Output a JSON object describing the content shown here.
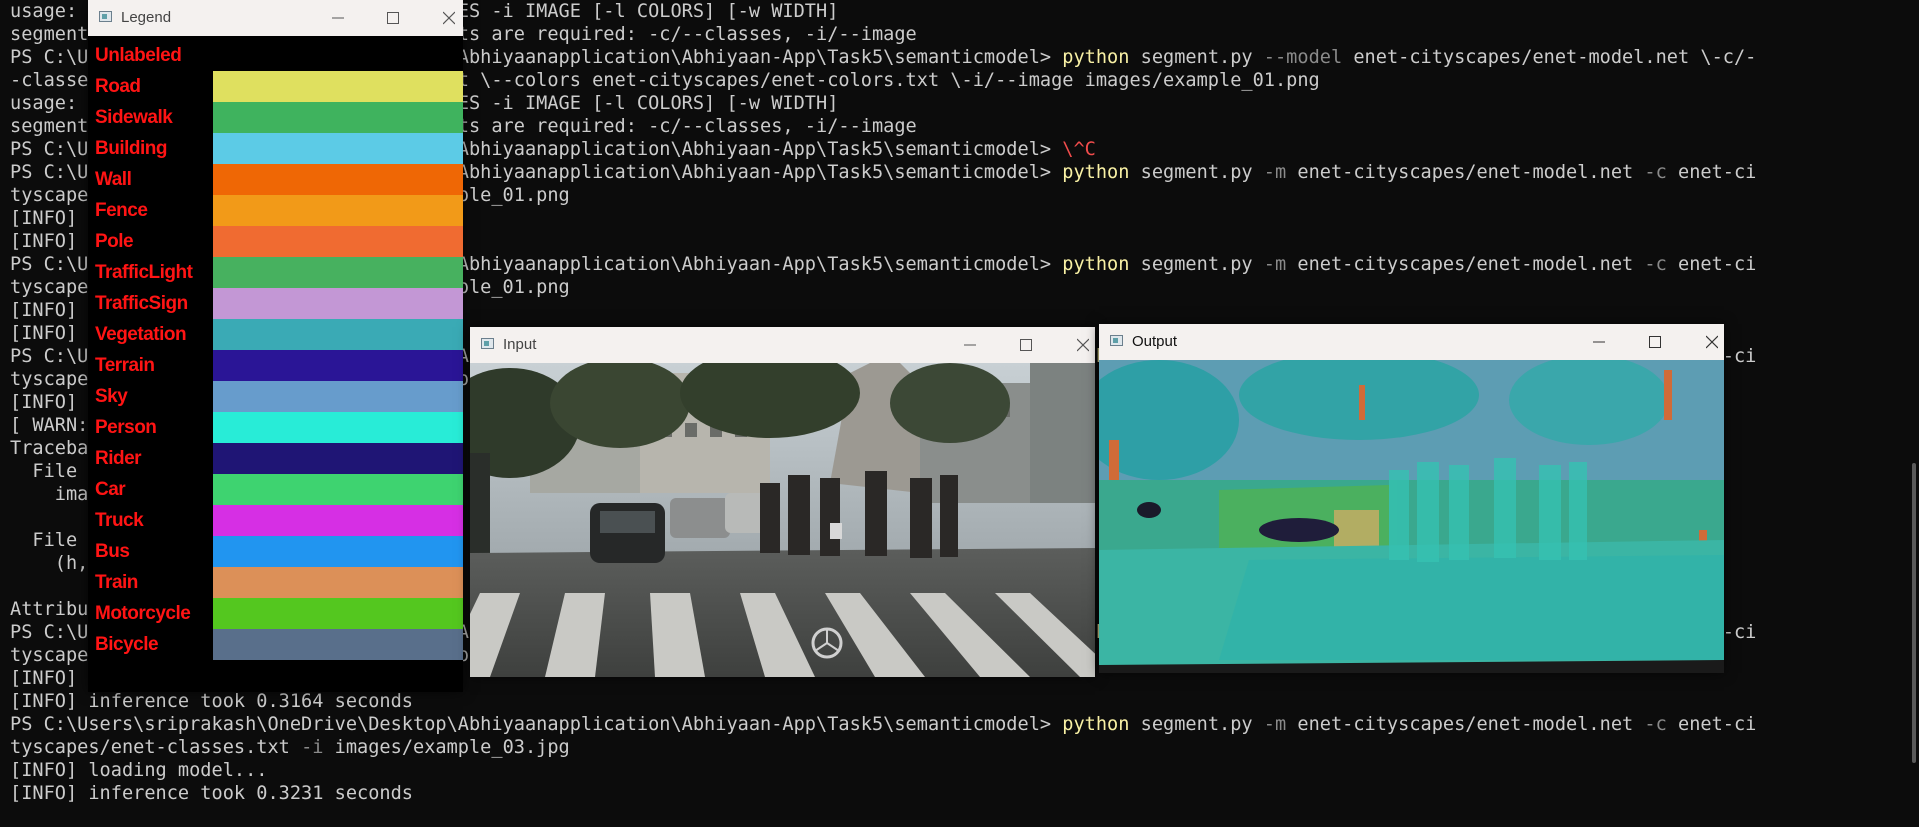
{
  "terminal": {
    "lines": [
      [
        {
          "t": "usage: segment.py [-h] -m MODEL -c CLASSES -i IMAGE [-l COLORS] [-w WIDTH]",
          "c": "#cccccc"
        }
      ],
      [
        {
          "t": "segment.py: error: the following arguments are required: -c/--classes, -i/--image",
          "c": "#cccccc"
        }
      ],
      [
        {
          "t": "PS C:\\Users\\sriprakash\\OneDrive\\Desktop\\Abhiyaanapplication\\Abhiyaan-App\\Task5\\semanticmodel> ",
          "c": "#cccccc"
        },
        {
          "t": "python",
          "c": "#f9f1a5"
        },
        {
          "t": " segment.py ",
          "c": "#cccccc"
        },
        {
          "t": "--model",
          "c": "#8a8a8a"
        },
        {
          "t": " enet-cityscapes/enet-model.net \\-c/-",
          "c": "#cccccc"
        }
      ],
      [
        {
          "t": "-classes enet-cityscapes/enet-classes.txt \\--colors enet-cityscapes/enet-colors.txt \\-i/--image images/example_01.png",
          "c": "#cccccc"
        }
      ],
      [
        {
          "t": "usage: segment.py [-h] -m MODEL -c CLASSES -i IMAGE [-l COLORS] [-w WIDTH]",
          "c": "#cccccc"
        }
      ],
      [
        {
          "t": "segment.py: error: the following arguments are required: -c/--classes, -i/--image",
          "c": "#cccccc"
        }
      ],
      [
        {
          "t": "PS C:\\Users\\sriprakash\\OneDrive\\Desktop\\Abhiyaanapplication\\Abhiyaan-App\\Task5\\semanticmodel> ",
          "c": "#cccccc"
        },
        {
          "t": "\\^C",
          "c": "#f14c4c"
        }
      ],
      [
        {
          "t": "PS C:\\Users\\sriprakash\\OneDrive\\Desktop\\Abhiyaanapplication\\Abhiyaan-App\\Task5\\semanticmodel> ",
          "c": "#cccccc"
        },
        {
          "t": "python",
          "c": "#f9f1a5"
        },
        {
          "t": " segment.py ",
          "c": "#cccccc"
        },
        {
          "t": "-m",
          "c": "#8a8a8a"
        },
        {
          "t": " enet-cityscapes/enet-model.net ",
          "c": "#cccccc"
        },
        {
          "t": "-c",
          "c": "#8a8a8a"
        },
        {
          "t": " enet-ci",
          "c": "#cccccc"
        }
      ],
      [
        {
          "t": "tyscapes/enet-classes.txt -i images/example_01.png",
          "c": "#cccccc"
        }
      ],
      [
        {
          "t": "[INFO] loading model...",
          "c": "#cccccc"
        }
      ],
      [
        {
          "t": "[INFO] inference took 0.3164 seconds",
          "c": "#cccccc"
        }
      ],
      [
        {
          "t": "PS C:\\Users\\sriprakash\\OneDrive\\Desktop\\Abhiyaanapplication\\Abhiyaan-App\\Task5\\semanticmodel> ",
          "c": "#cccccc"
        },
        {
          "t": "python",
          "c": "#f9f1a5"
        },
        {
          "t": " segment.py ",
          "c": "#cccccc"
        },
        {
          "t": "-m",
          "c": "#8a8a8a"
        },
        {
          "t": " enet-cityscapes/enet-model.net ",
          "c": "#cccccc"
        },
        {
          "t": "-c",
          "c": "#8a8a8a"
        },
        {
          "t": " enet-ci",
          "c": "#cccccc"
        }
      ],
      [
        {
          "t": "tyscapes/enet-classes.txt -i images/example_01.png",
          "c": "#cccccc"
        }
      ],
      [
        {
          "t": "[INFO] loading model...",
          "c": "#cccccc"
        }
      ],
      [
        {
          "t": "[INFO] inference took 0.3164 seconds",
          "c": "#cccccc"
        }
      ],
      [
        {
          "t": "PS C:\\Users\\sriprakash\\OneDrive\\Desktop\\Abhiyaanapplication\\Abhiyaan-App\\Task5\\semanticmodel> ",
          "c": "#cccccc"
        },
        {
          "t": "python",
          "c": "#f9f1a5"
        },
        {
          "t": " segment.py ",
          "c": "#cccccc"
        },
        {
          "t": "-m",
          "c": "#8a8a8a"
        },
        {
          "t": " enet-cityscapes/enet-model.net ",
          "c": "#cccccc"
        },
        {
          "t": "-c",
          "c": "#8a8a8a"
        },
        {
          "t": " enet-ci",
          "c": "#cccccc"
        }
      ],
      [
        {
          "t": "tyscapes/enet-classes.txt -i images/example_01.png",
          "c": "#cccccc"
        }
      ],
      [
        {
          "t": "[INFO] loading model...",
          "c": "#cccccc"
        }
      ],
      [
        {
          "t": "[ WARN:0] global",
          "c": "#cccccc"
        }
      ],
      [
        {
          "t": "Traceback (most recent call last):",
          "c": "#cccccc"
        }
      ],
      [
        {
          "t": "  File \"segment.py\"",
          "c": "#cccccc"
        }
      ],
      [
        {
          "t": "    image",
          "c": "#cccccc"
        }
      ],
      [
        {
          "t": "",
          "c": "#cccccc"
        }
      ],
      [
        {
          "t": "  File \"segment.py\"",
          "c": "#cccccc"
        }
      ],
      [
        {
          "t": "    (h, w)",
          "c": "#cccccc"
        }
      ],
      [
        {
          "t": "",
          "c": "#cccccc"
        }
      ],
      [
        {
          "t": "AttributeError: 'NoneType' object has no attribute 'shape'",
          "c": "#cccccc"
        }
      ],
      [
        {
          "t": "PS C:\\Users\\sriprakash\\OneDrive\\Desktop\\Abhiyaanapplication\\Abhiyaan-App\\Task5\\semanticmodel> ",
          "c": "#cccccc"
        },
        {
          "t": "python",
          "c": "#f9f1a5"
        },
        {
          "t": " segment.py ",
          "c": "#cccccc"
        },
        {
          "t": "-m",
          "c": "#8a8a8a"
        },
        {
          "t": " enet-cityscapes/enet-model.net ",
          "c": "#cccccc"
        },
        {
          "t": "-c",
          "c": "#8a8a8a"
        },
        {
          "t": " enet-ci",
          "c": "#cccccc"
        }
      ],
      [
        {
          "t": "tyscapes/enet-classes.txt -i images/example_02.jpg",
          "c": "#cccccc"
        }
      ],
      [
        {
          "t": "[INFO] loading model...",
          "c": "#cccccc"
        }
      ],
      [
        {
          "t": "[INFO] inference took 0.3164 seconds",
          "c": "#cccccc"
        }
      ],
      [
        {
          "t": "PS C:\\Users\\sriprakash\\OneDrive\\Desktop\\Abhiyaanapplication\\Abhiyaan-App\\Task5\\semanticmodel> ",
          "c": "#cccccc"
        },
        {
          "t": "python",
          "c": "#f9f1a5"
        },
        {
          "t": " segment.py ",
          "c": "#cccccc"
        },
        {
          "t": "-m",
          "c": "#8a8a8a"
        },
        {
          "t": " enet-cityscapes/enet-model.net ",
          "c": "#cccccc"
        },
        {
          "t": "-c",
          "c": "#8a8a8a"
        },
        {
          "t": " enet-ci",
          "c": "#cccccc"
        }
      ],
      [
        {
          "t": "tyscapes/enet-classes.txt ",
          "c": "#cccccc"
        },
        {
          "t": "-i",
          "c": "#8a8a8a"
        },
        {
          "t": " images/example_03.jpg",
          "c": "#cccccc"
        }
      ],
      [
        {
          "t": "[INFO] loading model...",
          "c": "#cccccc"
        }
      ],
      [
        {
          "t": "[INFO] inference took 0.3231 seconds",
          "c": "#cccccc"
        }
      ]
    ]
  },
  "legend": {
    "title": "Legend",
    "icon": "opencv-window-icon",
    "classes": [
      {
        "name": "Unlabeled",
        "color": "#000000"
      },
      {
        "name": "Road",
        "color": "#dfe05f"
      },
      {
        "name": "Sidewalk",
        "color": "#3fb35e"
      },
      {
        "name": "Building",
        "color": "#5ccbe6"
      },
      {
        "name": "Wall",
        "color": "#ef6705"
      },
      {
        "name": "Fence",
        "color": "#f29a18"
      },
      {
        "name": "Pole",
        "color": "#f06b31"
      },
      {
        "name": "TrafficLight",
        "color": "#47b15f"
      },
      {
        "name": "TrafficSign",
        "color": "#c397d5"
      },
      {
        "name": "Vegetation",
        "color": "#3aaab5"
      },
      {
        "name": "Terrain",
        "color": "#2a1596"
      },
      {
        "name": "Sky",
        "color": "#679ccc"
      },
      {
        "name": "Person",
        "color": "#28ecd7"
      },
      {
        "name": "Rider",
        "color": "#1f1575"
      },
      {
        "name": "Car",
        "color": "#3ed370"
      },
      {
        "name": "Truck",
        "color": "#d62fe4"
      },
      {
        "name": "Bus",
        "color": "#2195f0"
      },
      {
        "name": "Train",
        "color": "#dc9058"
      },
      {
        "name": "Motorcycle",
        "color": "#54c71f"
      },
      {
        "name": "Bicycle",
        "color": "#596f8b"
      }
    ]
  },
  "input_window": {
    "title": "Input"
  },
  "output_window": {
    "title": "Output"
  },
  "window_controls": {
    "minimize": "minimize-icon",
    "maximize": "maximize-icon",
    "close": "close-icon"
  }
}
